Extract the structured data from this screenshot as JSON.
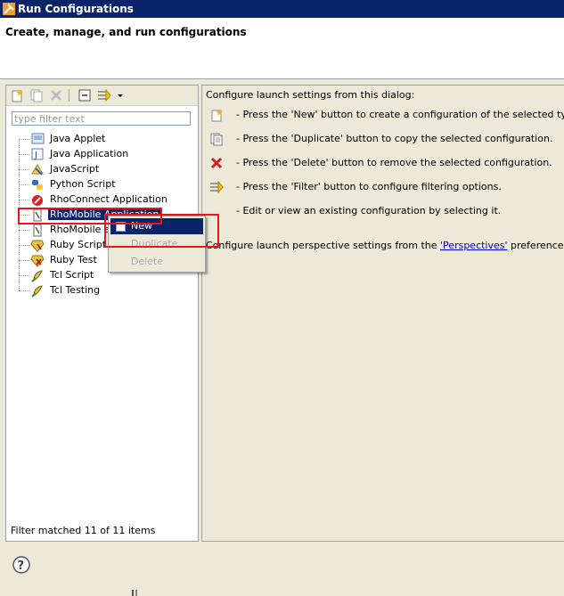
{
  "window": {
    "title": "Run Configurations",
    "app_icon": "tools-icon"
  },
  "header": {
    "title": "Create, manage, and run configurations"
  },
  "toolbar": {
    "buttons": [
      {
        "name": "new-config-button",
        "icon": "new-config-icon"
      },
      {
        "name": "duplicate-button",
        "icon": "duplicate-icon"
      },
      {
        "name": "delete-button",
        "icon": "delete-icon"
      },
      {
        "name": "collapse-all-button",
        "icon": "collapse-all-icon"
      },
      {
        "name": "filter-button",
        "icon": "filter-icon"
      },
      {
        "name": "filter-menu-button",
        "icon": "dropdown-arrow-icon"
      }
    ]
  },
  "filter": {
    "placeholder": "type filter text",
    "value": ""
  },
  "tree": {
    "items": [
      {
        "label": "Java Applet",
        "icon": "java-applet-icon"
      },
      {
        "label": "Java Application",
        "icon": "java-application-icon"
      },
      {
        "label": "JavaScript",
        "icon": "javascript-icon"
      },
      {
        "label": "Python Script",
        "icon": "python-icon"
      },
      {
        "label": "RhoConnect Application",
        "icon": "rhoconnect-icon"
      },
      {
        "label": "RhoMobile Application",
        "icon": "rhomobile-icon",
        "selected": true
      },
      {
        "label": "RhoMobile application test",
        "icon": "rhomobile-icon"
      },
      {
        "label": "Ruby Script",
        "icon": "ruby-icon"
      },
      {
        "label": "Ruby Test",
        "icon": "ruby-test-icon"
      },
      {
        "label": "Tcl Script",
        "icon": "tcl-icon"
      },
      {
        "label": "Tcl Testing",
        "icon": "tcl-icon"
      }
    ]
  },
  "filter_status": "Filter matched 11 of 11 items",
  "context_menu": {
    "items": [
      {
        "label": "New",
        "state": "active"
      },
      {
        "label": "Duplicate",
        "state": "disabled"
      },
      {
        "label": "Delete",
        "state": "disabled"
      }
    ]
  },
  "right_panel": {
    "intro": "Configure launch settings from this dialog:",
    "instructions": [
      {
        "text": "- Press the 'New' button to create a configuration of the selected type.",
        "icon": "new-config-icon"
      },
      {
        "text": "- Press the 'Duplicate' button to copy the selected configuration.",
        "icon": "duplicate-icon"
      },
      {
        "text": "- Press the 'Delete' button to remove the selected configuration.",
        "icon": "delete-icon"
      },
      {
        "text": "- Press the 'Filter' button to configure filtering options.",
        "icon": "filter-icon"
      },
      {
        "text": "- Edit or view an existing configuration by selecting it.",
        "icon": ""
      }
    ],
    "perspectives_prefix": "Configure launch perspective settings from the",
    "perspectives_link": "'Perspectives'",
    "perspectives_suffix": "preference page"
  },
  "colors": {
    "titlebar": "#0a246a",
    "selection": "#0a246a",
    "highlight": "#e8151c",
    "link": "#0000cc"
  }
}
